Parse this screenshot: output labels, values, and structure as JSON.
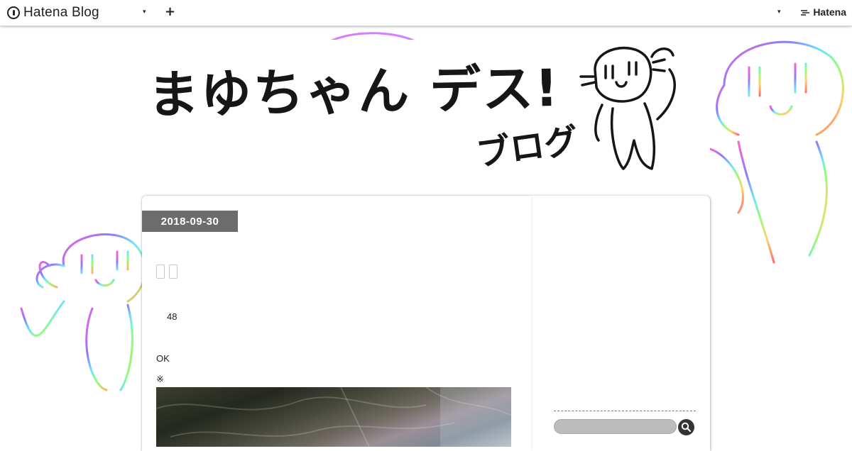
{
  "topbar": {
    "logo_text": "Hatena Blog",
    "brand_right": "Hatena",
    "caret": "▾",
    "plus": "+"
  },
  "header": {
    "title": "まゆちゃん デス!",
    "subtitle": "ブログ"
  },
  "entry": {
    "date": "2018-09-30",
    "text_1": "48",
    "text_2": "OK",
    "text_3": "※"
  },
  "sidebar": {
    "search_placeholder": ""
  },
  "icons": {
    "logo": "hatena-blog-logo-icon",
    "add": "plus-icon",
    "dropdown": "caret-down-icon",
    "search": "search-icon"
  },
  "colors": {
    "topbar_bg": "#ffffff",
    "date_badge_bg": "#6c6c6c",
    "search_field_bg": "#bcbcbc",
    "search_button_bg": "#333333"
  }
}
